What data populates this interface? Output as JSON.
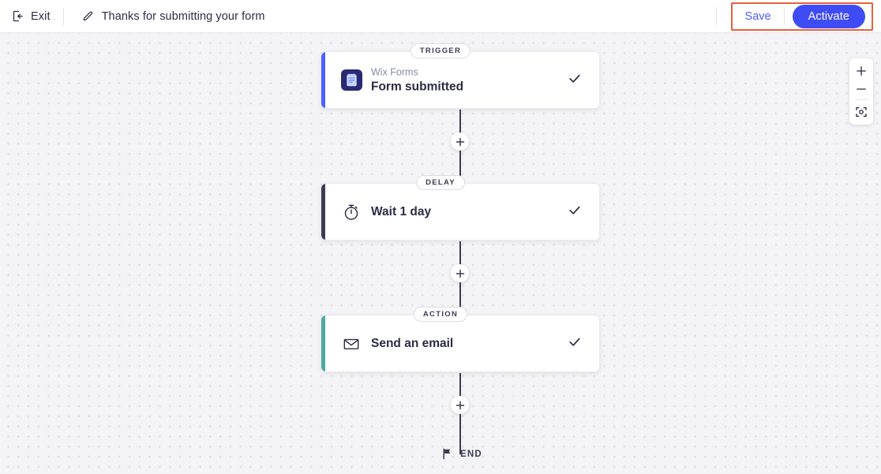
{
  "header": {
    "exit": {
      "label": "Exit",
      "icon": "exit-icon"
    },
    "edit_icon": "pencil-icon",
    "title": "Thanks for submitting your form",
    "save_label": "Save",
    "activate_label": "Activate",
    "highlight_color": "#e8603c",
    "save_color": "#4c5fff",
    "activate_color": "#3f4cf5"
  },
  "canvas": {
    "nodes": [
      {
        "badge": "TRIGGER",
        "app": "Wix Forms",
        "title": "Form submitted",
        "icon": "form-clipboard-icon",
        "accent": "#4c5fff",
        "checked": true
      },
      {
        "badge": "DELAY",
        "app": "",
        "title": "Wait 1 day",
        "icon": "stopwatch-icon",
        "accent": "#3b3b53",
        "checked": true
      },
      {
        "badge": "ACTION",
        "app": "",
        "title": "Send an email",
        "icon": "envelope-icon",
        "accent": "#4ea8a0",
        "checked": true
      }
    ],
    "add_button_icon": "plus-icon",
    "end": {
      "label": "END",
      "icon": "flag-icon"
    }
  },
  "zoom_controls": {
    "zoom_in": "plus-icon",
    "zoom_out": "minus-icon",
    "fit_screen": "fit-to-screen-icon"
  }
}
